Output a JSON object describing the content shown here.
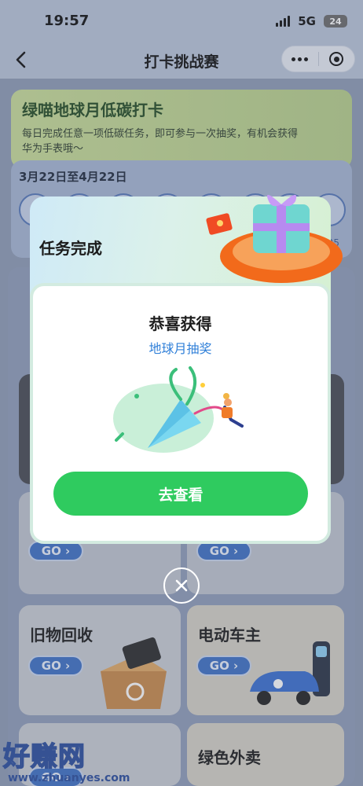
{
  "status_bar": {
    "time": "19:57",
    "network": "5G",
    "battery": "24"
  },
  "nav": {
    "title": "打卡挑战赛"
  },
  "banner": {
    "title": "绿喵地球月低碳打卡",
    "description": "每日完成任意一项低碳任务，即可参与一次抽奖，有机会获得华为手表哦～"
  },
  "calendar": {
    "date_range": "3月22日至4月22日",
    "last_visible_day": "25"
  },
  "tasks": [
    {
      "title": "旧物回收",
      "go_label": "GO ›"
    },
    {
      "title": "电动车主",
      "go_label": "GO ›"
    },
    {
      "title": "绿色外卖",
      "go_label": "GO ›"
    }
  ],
  "background_go_label": "GO ›",
  "modal": {
    "title": "任务完成",
    "prize_label": "恭喜获得",
    "prize_name": "地球月抽奖",
    "button_label": "去查看"
  },
  "watermark": {
    "text": "好赚网",
    "url": "www.zhuanyes.com"
  },
  "colors": {
    "primary_green": "#2fcb5f",
    "link_blue": "#2f7fd8",
    "go_blue": "#3e70c4"
  }
}
